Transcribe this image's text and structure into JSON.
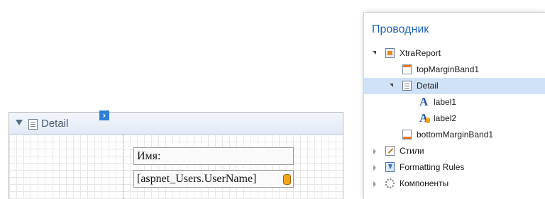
{
  "designer": {
    "band_title": "Detail",
    "smart_tag": "›",
    "labels": [
      {
        "text": "Имя:"
      },
      {
        "text": "[aspnet_Users.UserName]"
      }
    ]
  },
  "explorer": {
    "title": "Проводник",
    "items": [
      {
        "label": "XtraReport",
        "icon": "report-icon",
        "expander": "open"
      },
      {
        "label": "topMarginBand1",
        "icon": "top-margin-band-icon",
        "expander": "none"
      },
      {
        "label": "Detail",
        "icon": "detail-band-icon",
        "expander": "open",
        "selected": true
      },
      {
        "label": "label1",
        "icon": "label-icon",
        "expander": "none"
      },
      {
        "label": "label2",
        "icon": "bound-label-icon",
        "expander": "none"
      },
      {
        "label": "bottomMarginBand1",
        "icon": "bottom-margin-band-icon",
        "expander": "none"
      },
      {
        "label": "Стили",
        "icon": "styles-icon",
        "expander": "closed"
      },
      {
        "label": "Formatting Rules",
        "icon": "formatting-rules-icon",
        "expander": "closed"
      },
      {
        "label": "Компоненты",
        "icon": "components-icon",
        "expander": "closed"
      }
    ]
  }
}
